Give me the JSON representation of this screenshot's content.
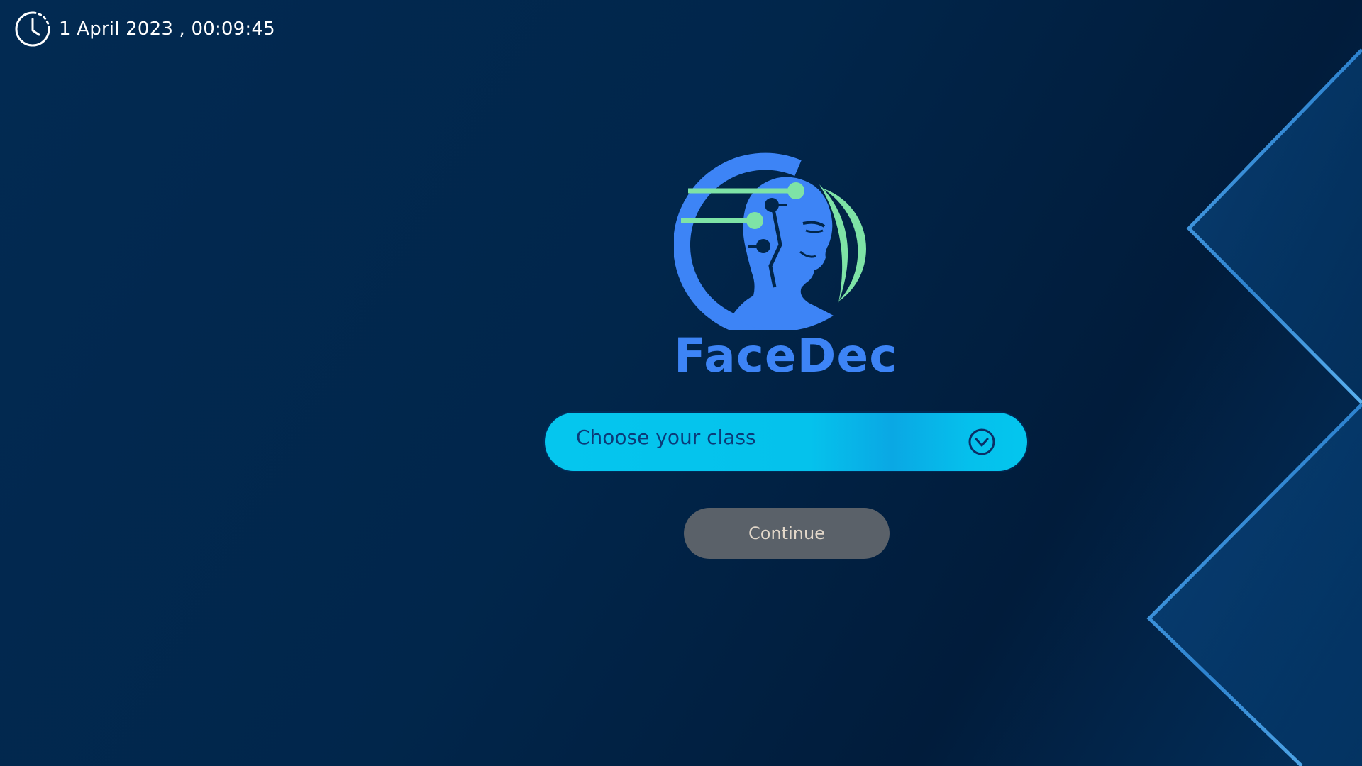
{
  "header": {
    "datetime": "1 April 2023 , 00:09:45",
    "clock_icon": "clock-icon"
  },
  "brand": {
    "name": "FaceDec",
    "logo_icon": "face-recognition-logo",
    "color": "#3d84f6",
    "accent": "#7ee3a6"
  },
  "class_select": {
    "placeholder": "Choose your class",
    "icon": "chevron-down-circle-icon",
    "background": "#05c6ee",
    "text_color": "#0b3a78"
  },
  "continue_button": {
    "label": "Continue",
    "background": "#5a6169",
    "text_color": "#e2d7c9"
  },
  "theme": {
    "background": "#01264b",
    "decor_line": "#3a8fd8"
  }
}
